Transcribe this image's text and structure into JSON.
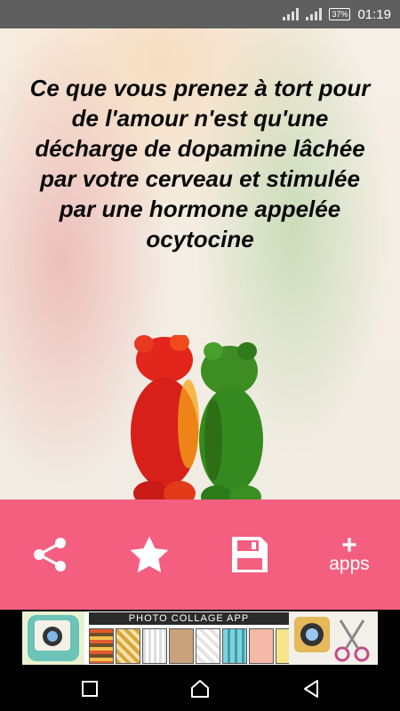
{
  "status_bar": {
    "battery": "37%",
    "time": "01:19",
    "icons": [
      "signal-icon",
      "battery-icon"
    ]
  },
  "quote": {
    "text": "Ce que vous prenez à tort pour de l'amour n'est qu'une décharge de dopamine lâchée par votre cerveau et stimulée par une hormone appelée ocytocine"
  },
  "actions": {
    "share_icon": "share-icon",
    "favorite_icon": "star-icon",
    "save_icon": "floppy-disk-icon",
    "apps_plus": "+",
    "apps_label": "apps"
  },
  "ad": {
    "title": "PHOTO COLLAGE APP"
  },
  "nav": {
    "icons": [
      "recents-icon",
      "home-icon",
      "back-icon"
    ]
  },
  "colors": {
    "action_bar": "#f45f80",
    "status_bar": "#5f5f5f"
  }
}
